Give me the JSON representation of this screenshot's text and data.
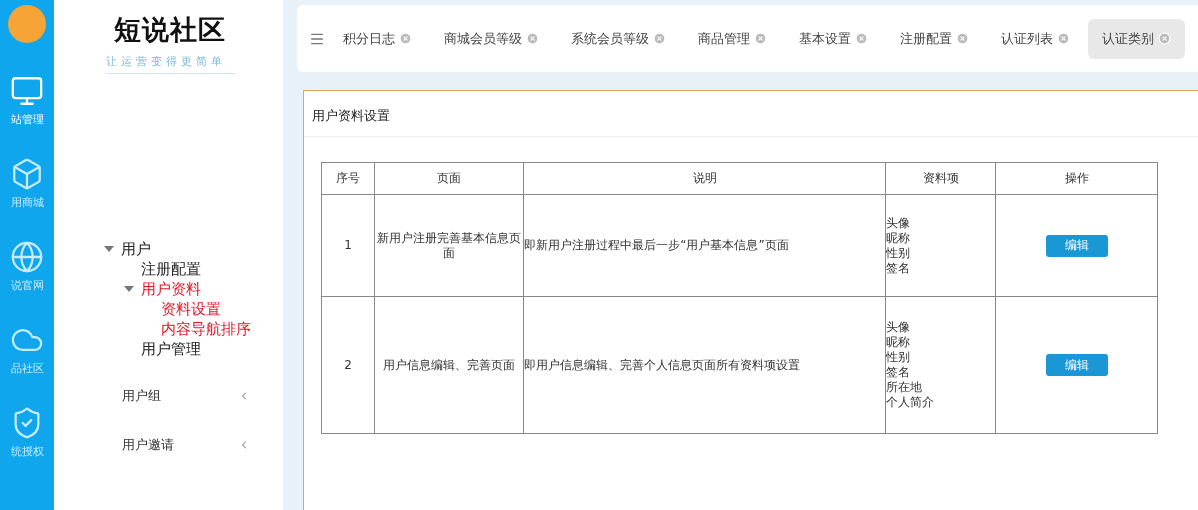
{
  "rail": {
    "items": [
      {
        "kind": "monitor",
        "label": "站管理",
        "selected": true
      },
      {
        "kind": "box",
        "label": "用商城",
        "selected": false
      },
      {
        "kind": "globe",
        "label": "说官网",
        "selected": false
      },
      {
        "kind": "cloud",
        "label": "品社区",
        "selected": false
      },
      {
        "kind": "shield",
        "label": "统授权",
        "selected": false
      }
    ]
  },
  "sidebar": {
    "logo": "短说社区",
    "slogan": "让运营变得更简单",
    "tree": [
      {
        "label": "用户",
        "expanded": true,
        "selected": false,
        "children": [
          {
            "label": "注册配置",
            "selected": false
          },
          {
            "label": "用户资料",
            "expanded": true,
            "selected": true,
            "children": [
              {
                "label": "资料设置",
                "selected": true
              },
              {
                "label": "内容导航排序",
                "selected": true
              }
            ]
          },
          {
            "label": "用户管理",
            "selected": false
          }
        ]
      }
    ],
    "menu": [
      {
        "label": "用户组"
      },
      {
        "label": "用户邀请"
      }
    ]
  },
  "tabs": [
    {
      "label": "积分日志",
      "selected": false
    },
    {
      "label": "商城会员等级",
      "selected": false
    },
    {
      "label": "系统会员等级",
      "selected": false
    },
    {
      "label": "商品管理",
      "selected": false
    },
    {
      "label": "基本设置",
      "selected": false
    },
    {
      "label": "注册配置",
      "selected": false
    },
    {
      "label": "认证列表",
      "selected": false
    },
    {
      "label": "认证类别",
      "selected": true
    }
  ],
  "panel": {
    "title": "用户资料设置",
    "table": {
      "columns": [
        "序号",
        "页面",
        "说明",
        "资料项",
        "操作"
      ],
      "rows": [
        {
          "index": "1",
          "page": "新用户注册完善基本信息页面",
          "description": "即新用户注册过程中最后一步“用户基本信息”页面",
          "fields": [
            "头像",
            "昵称",
            "性别",
            "签名"
          ],
          "action": "编辑"
        },
        {
          "index": "2",
          "page": "用户信息编辑、完善页面",
          "description": "即用户信息编辑、完善个人信息页面所有资料项设置",
          "fields": [
            "头像",
            "昵称",
            "性别",
            "签名",
            "所在地",
            "个人简介"
          ],
          "action": "编辑"
        }
      ]
    }
  }
}
